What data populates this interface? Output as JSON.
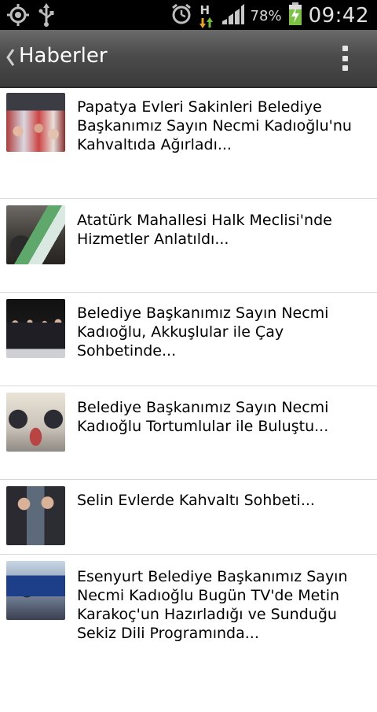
{
  "status_bar": {
    "battery_percent": "78%",
    "time": "09:42",
    "network_type": "H",
    "icons": [
      "gps-icon",
      "usb-icon",
      "alarm-icon",
      "network-h-icon",
      "signal-icon",
      "battery-charging-icon"
    ]
  },
  "action_bar": {
    "title": "Haberler",
    "icons": [
      "back-chevron-icon",
      "overflow-menu-icon"
    ]
  },
  "news": [
    {
      "title": "Papatya Evleri Sakinleri Belediye Başkanımız Sayın Necmi Kadıoğlu'nu Kahvaltıda Ağırladı..."
    },
    {
      "title": "Atatürk Mahallesi Halk Meclisi'nde Hizmetler Anlatıldı..."
    },
    {
      "title": "Belediye Başkanımız Sayın Necmi Kadıoğlu, Akkuşlular ile Çay Sohbetinde..."
    },
    {
      "title": "Belediye Başkanımız Sayın Necmi Kadıoğlu Tortumlular ile Buluştu..."
    },
    {
      "title": "Selin Evlerde Kahvaltı Sohbeti..."
    },
    {
      "title": "Esenyurt Belediye Başkanımız Sayın Necmi Kadıoğlu Bugün TV'de Metin Karakoç'un Hazırladığı ve Sunduğu Sekiz Dili Programında..."
    }
  ],
  "colors": {
    "status_bar_bg": "#000000",
    "action_bar_bg": "#4b4b4b",
    "divider": "#d9d9d9",
    "battery_green": "#7bc142"
  }
}
